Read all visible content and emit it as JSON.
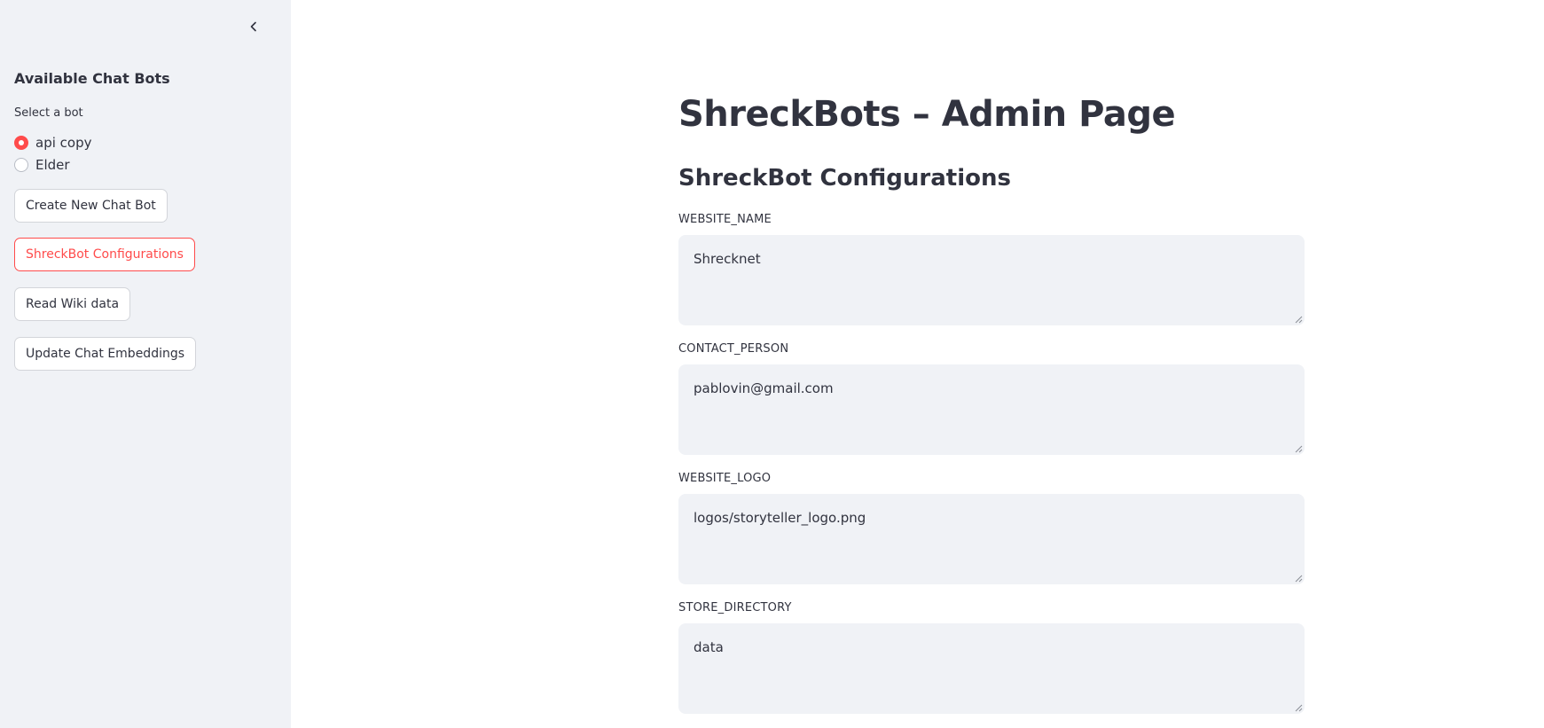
{
  "sidebar": {
    "collapse_icon": "chevron-left-icon",
    "header": "Available Chat Bots",
    "radio_label": "Select a bot",
    "radio_options": [
      {
        "label": "api copy",
        "selected": true
      },
      {
        "label": "Elder",
        "selected": false
      }
    ],
    "buttons": {
      "create": "Create New Chat Bot",
      "configurations": "ShreckBot Configurations",
      "read_wiki": "Read Wiki data",
      "update_embeddings": "Update Chat Embeddings"
    },
    "active_button": "configurations"
  },
  "main": {
    "title": "ShreckBots – Admin Page",
    "section_title": "ShreckBot Configurations",
    "fields": [
      {
        "label": "WEBSITE_NAME",
        "value": "Shrecknet"
      },
      {
        "label": "CONTACT_PERSON",
        "value": "pablovin@gmail.com"
      },
      {
        "label": "WEBSITE_LOGO",
        "value": "logos/storyteller_logo.png"
      },
      {
        "label": "STORE_DIRECTORY",
        "value": "data"
      }
    ]
  },
  "colors": {
    "accent": "#ff4b4b",
    "sidebar_bg": "#f0f2f6",
    "text": "#31333f",
    "input_bg": "#f0f2f6"
  }
}
